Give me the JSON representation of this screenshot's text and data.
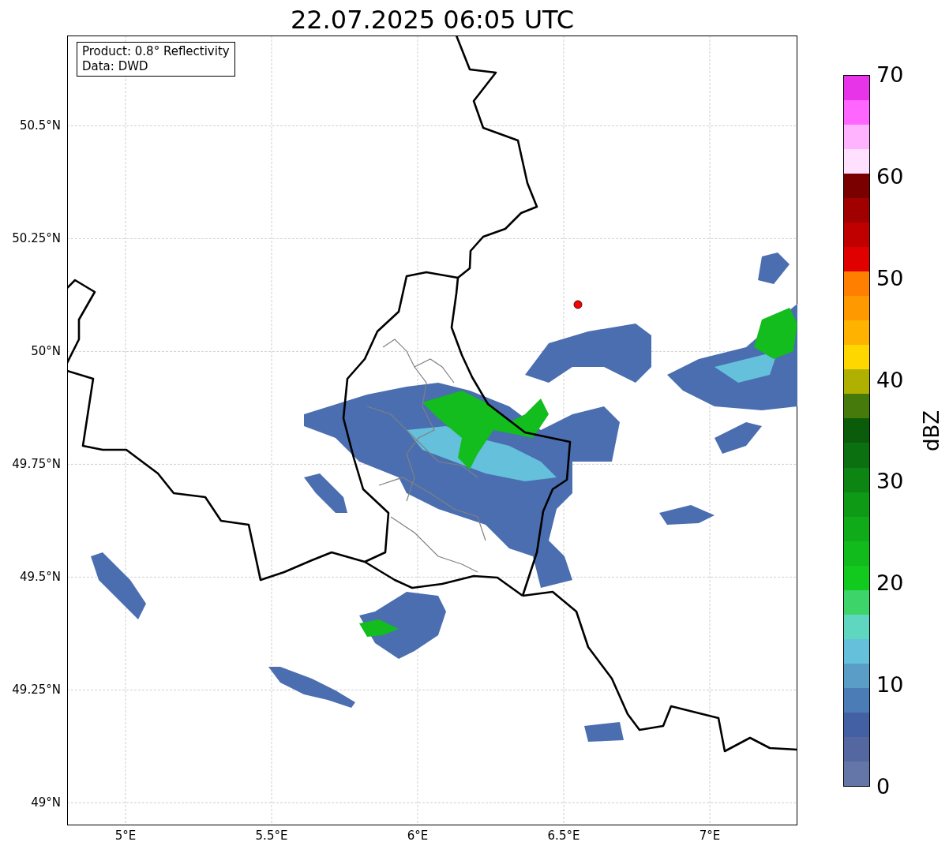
{
  "title": "22.07.2025 06:05 UTC",
  "info_box": [
    "Product: 0.8° Reflectivity",
    "Data: DWD"
  ],
  "map": {
    "yticks": [
      "50.5°N",
      "50.25°N",
      "50°N",
      "49.75°N",
      "49.5°N",
      "49.25°N",
      "49°N"
    ],
    "xticks": [
      "5°E",
      "5.5°E",
      "6°E",
      "6.5°E",
      "7°E"
    ]
  },
  "colorbar": {
    "label": "dBZ",
    "ticks": [
      "70",
      "60",
      "50",
      "40",
      "30",
      "20",
      "10",
      "0"
    ],
    "segments": [
      {
        "color": "#e834e8"
      },
      {
        "color": "#ff66ff"
      },
      {
        "color": "#ffb3ff"
      },
      {
        "color": "#ffe0ff"
      },
      {
        "color": "#7a0000"
      },
      {
        "color": "#a00000"
      },
      {
        "color": "#c00000"
      },
      {
        "color": "#e00000"
      },
      {
        "color": "#ff7f00"
      },
      {
        "color": "#ff9900"
      },
      {
        "color": "#ffb300"
      },
      {
        "color": "#ffd700"
      },
      {
        "color": "#b0b000"
      },
      {
        "color": "#467a0a"
      },
      {
        "color": "#0a5c0a"
      },
      {
        "color": "#0a7010"
      },
      {
        "color": "#0c8512"
      },
      {
        "color": "#0f9a16"
      },
      {
        "color": "#10ab18"
      },
      {
        "color": "#11bb1c"
      },
      {
        "color": "#12c91e"
      },
      {
        "color": "#3dd46a"
      },
      {
        "color": "#5fd6c0"
      },
      {
        "color": "#65c0dc"
      },
      {
        "color": "#5a9ec8"
      },
      {
        "color": "#4b7cb5"
      },
      {
        "color": "#4360a5"
      },
      {
        "color": "#5467a0"
      },
      {
        "color": "#6476a8"
      }
    ]
  }
}
